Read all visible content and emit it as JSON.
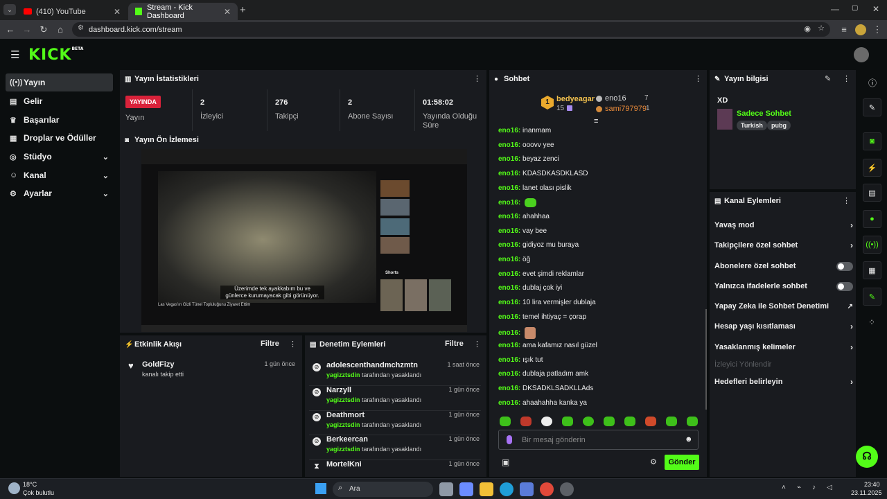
{
  "browser": {
    "tabs": [
      {
        "title": "(410) YouTube"
      },
      {
        "title": "Stream - Kick Dashboard"
      }
    ],
    "url": "dashboard.kick.com/stream"
  },
  "brand": {
    "logo": "KICK",
    "beta": "BETA",
    "accent": "#53fc18"
  },
  "sidebar": {
    "items": [
      {
        "label": "Yayın",
        "icon": "broadcast-icon"
      },
      {
        "label": "Gelir",
        "icon": "revenue-icon"
      },
      {
        "label": "Başarılar",
        "icon": "trophy-icon"
      },
      {
        "label": "Droplar ve Ödüller",
        "icon": "gift-icon"
      },
      {
        "label": "Stüdyo",
        "icon": "studio-icon"
      },
      {
        "label": "Kanal",
        "icon": "channel-icon"
      },
      {
        "label": "Ayarlar",
        "icon": "settings-icon"
      }
    ]
  },
  "stats": {
    "title": "Yayın İstatistikleri",
    "live_badge": "YAYINDA",
    "live_label": "Yayın",
    "items": [
      {
        "value": "2",
        "label": "İzleyici"
      },
      {
        "value": "276",
        "label": "Takipçi"
      },
      {
        "value": "2",
        "label": "Abone Sayısı"
      },
      {
        "value": "01:58:02",
        "label": "Yayında Olduğu Süre"
      }
    ]
  },
  "preview": {
    "title": "Yayın Ön İzlemesi",
    "subtitle_line1": "Üzerimde tek ayakkabım bu ve",
    "subtitle_line2": "günlerce kurumayacak gibi görünüyor.",
    "video_title": "Las Vegas'ın Gizli Tünel Topluluğunu Ziyaret Ettim",
    "shorts": "Shorts"
  },
  "activity": {
    "title": "Etkinlik Akışı",
    "filter": "Filtre",
    "events": [
      {
        "user": "GoldFizy",
        "time": "1 gün önce",
        "text": "kanalı takip etti"
      }
    ]
  },
  "moderation": {
    "title": "Denetim Eylemleri",
    "filter": "Filtre",
    "by_label": "tarafından yasaklandı",
    "events": [
      {
        "user": "adolescenthandmchzmtn",
        "time": "1 saat önce",
        "moderator": "yagizztsdin"
      },
      {
        "user": "Narzyll",
        "time": "1 gün önce",
        "moderator": "yagizztsdin"
      },
      {
        "user": "Deathmort",
        "time": "1 gün önce",
        "moderator": "yagizztsdin"
      },
      {
        "user": "Berkeercan",
        "time": "1 gün önce",
        "moderator": "yagizztsdin"
      },
      {
        "user": "MortelKni",
        "time": "1 gün önce",
        "moderator": ""
      }
    ]
  },
  "chat": {
    "title": "Sohbet",
    "top": [
      {
        "rank": "1",
        "name": "bedyeagar",
        "count": "15"
      },
      {
        "name": "eno16",
        "count": "7"
      },
      {
        "name": "sami797979",
        "count": "1"
      }
    ],
    "messages": [
      {
        "user": "eno16",
        "text": "inanmam"
      },
      {
        "user": "eno16",
        "text": "ooovv yee"
      },
      {
        "user": "eno16",
        "text": "beyaz zenci"
      },
      {
        "user": "eno16",
        "text": "KDASDKASDKLASD"
      },
      {
        "user": "eno16",
        "text": "lanet olası pislik"
      },
      {
        "user": "eno16",
        "text": ""
      },
      {
        "user": "eno16",
        "text": "ahahhaa"
      },
      {
        "user": "eno16",
        "text": "vay bee"
      },
      {
        "user": "eno16",
        "text": "gidiyoz mu buraya"
      },
      {
        "user": "eno16",
        "text": "öğ"
      },
      {
        "user": "eno16",
        "text": "evet şimdi reklamlar"
      },
      {
        "user": "eno16",
        "text": "dublaj çok iyi"
      },
      {
        "user": "eno16",
        "text": "10 lira vermişler dublaja"
      },
      {
        "user": "eno16",
        "text": "temel ihtiyaç = çorap"
      },
      {
        "user": "eno16",
        "text": ""
      },
      {
        "user": "eno16",
        "text": "ama kafamız nasıl güzel"
      },
      {
        "user": "eno16",
        "text": "ışık tut"
      },
      {
        "user": "eno16",
        "text": "dublaja patladım amk"
      },
      {
        "user": "eno16",
        "text": "DKSADKLSADKLLAds"
      },
      {
        "user": "eno16",
        "text": "ahaahahha kanka ya"
      }
    ],
    "input_placeholder": "Bir mesaj gönderin",
    "send": "Gönder"
  },
  "stream_info": {
    "title": "Yayın bilgisi",
    "stream_title": "XD",
    "category": "Sadece Sohbet",
    "tags": [
      "Turkish",
      "pubg"
    ]
  },
  "channel_actions": {
    "title": "Kanal Eylemleri",
    "items": [
      {
        "label": "Yavaş mod",
        "type": "chevron"
      },
      {
        "label": "Takipçilere özel sohbet",
        "type": "chevron"
      },
      {
        "label": "Abonelere özel sohbet",
        "type": "toggle"
      },
      {
        "label": "Yalnızca ifadelerle sohbet",
        "type": "toggle"
      },
      {
        "label": "Yapay Zeka ile Sohbet Denetimi",
        "type": "external"
      },
      {
        "label": "Hesap yaşı kısıtlaması",
        "type": "chevron"
      },
      {
        "label": "Yasaklanmış kelimeler",
        "type": "chevron"
      },
      {
        "label": "İzleyici Yönlendir",
        "type": "disabled"
      },
      {
        "label": "Hedefleri belirleyin",
        "type": "chevron"
      }
    ]
  },
  "taskbar": {
    "weather_temp": "18°C",
    "weather_desc": "Çok bulutlu",
    "search": "Ara",
    "time": "23:40",
    "date": "23.11.2025"
  }
}
